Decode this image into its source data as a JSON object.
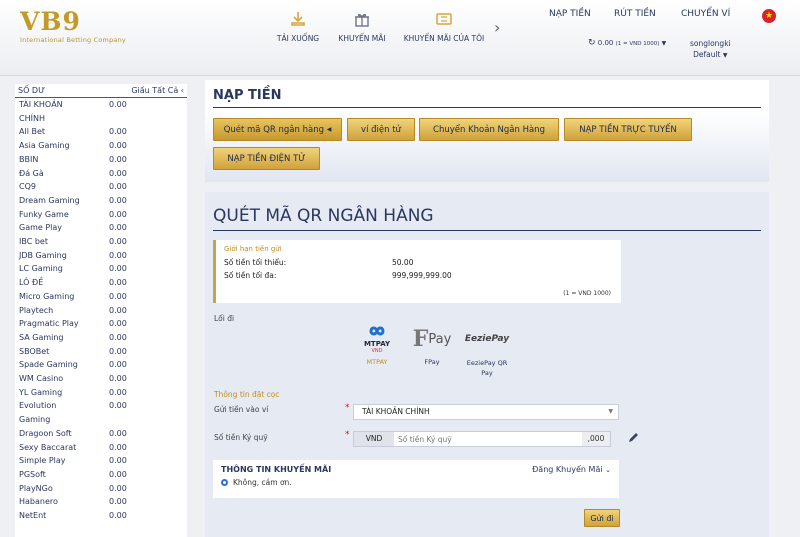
{
  "header": {
    "logo": "VB9",
    "logo_sub": "International Betting Company",
    "nav": [
      {
        "label": "TẢI XUỐNG",
        "icon": "download-icon"
      },
      {
        "label": "KHUYẾN MÃI",
        "icon": "gift-icon"
      },
      {
        "label": "KHUYẾN MÃI CỦA TÔI",
        "icon": "ticket-icon"
      }
    ],
    "links": {
      "deposit": "NẠP TIỀN",
      "withdraw": "RÚT TIỀN",
      "transfer": "CHUYỂN VÍ"
    },
    "balance": "0.00",
    "balance_note": "(1 = VND 1000)",
    "username": "songlongki",
    "profile": "Default",
    "flag": "★"
  },
  "sidebar": {
    "title": "SỐ DƯ",
    "hide_all": "Giấu Tất Cả",
    "rows": [
      {
        "name": "TÀI KHOẢN",
        "value": "0.00"
      },
      {
        "name": "CHÍNH",
        "value": ""
      },
      {
        "name": "All Bet",
        "value": "0.00"
      },
      {
        "name": "Asia Gaming",
        "value": "0.00"
      },
      {
        "name": "BBIN",
        "value": "0.00"
      },
      {
        "name": "Đá Gà",
        "value": "0.00"
      },
      {
        "name": "CQ9",
        "value": "0.00"
      },
      {
        "name": "Dream Gaming",
        "value": "0.00"
      },
      {
        "name": "Funky Game",
        "value": "0.00"
      },
      {
        "name": "Game Play",
        "value": "0.00"
      },
      {
        "name": "IBC bet",
        "value": "0.00"
      },
      {
        "name": "JDB Gaming",
        "value": "0.00"
      },
      {
        "name": "LC Gaming",
        "value": "0.00"
      },
      {
        "name": "LÔ ĐỀ",
        "value": "0.00"
      },
      {
        "name": "Micro Gaming",
        "value": "0.00"
      },
      {
        "name": "Playtech",
        "value": "0.00"
      },
      {
        "name": "Pragmatic Play",
        "value": "0.00"
      },
      {
        "name": "SA Gaming",
        "value": "0.00"
      },
      {
        "name": "SBOBet",
        "value": "0.00"
      },
      {
        "name": "Spade Gaming",
        "value": "0.00"
      },
      {
        "name": "WM Casino",
        "value": "0.00"
      },
      {
        "name": "YL Gaming",
        "value": "0.00"
      },
      {
        "name": "Evolution",
        "value": "0.00"
      },
      {
        "name": "Gaming",
        "value": ""
      },
      {
        "name": "Dragoon Soft",
        "value": "0.00"
      },
      {
        "name": "Sexy Baccarat",
        "value": "0.00"
      },
      {
        "name": "Simple Play",
        "value": "0.00"
      },
      {
        "name": "PGSoft",
        "value": "0.00"
      },
      {
        "name": "PlayNGo",
        "value": "0.00"
      },
      {
        "name": "Habanero",
        "value": "0.00"
      },
      {
        "name": "NetEnt",
        "value": "0.00"
      }
    ]
  },
  "deposit": {
    "title": "NẠP TIỀN",
    "methods": [
      "Quét mã QR ngân hàng",
      "ví điện tử",
      "Chuyển Khoản Ngân Hàng",
      "NẠP TIỀN TRỰC TUYẾN",
      "NẠP TIỀN ĐIỆN TỬ"
    ]
  },
  "form": {
    "title": "QUÉT MÃ QR NGÂN HÀNG",
    "limit_caption": "Giới hạn tiền gửi",
    "min_label": "Số tiền tối thiểu:",
    "min_value": "50.00",
    "max_label": "Số tiền tối đa:",
    "max_value": "999,999,999.00",
    "limit_note": "(1 = VND 1000)",
    "gateway_label": "Lối đi",
    "gateways": [
      {
        "name": "MTPAY",
        "logo": "MTPAY",
        "logo_sub": "VND"
      },
      {
        "name": "FPay",
        "logo": "Pay"
      },
      {
        "name": "EeziePay QR Pay",
        "logo": "EeziePay"
      }
    ],
    "deposit_info": "Thông tin đặt cọc",
    "wallet_label": "Gửi tiền vào ví",
    "wallet_value": "TÀI KHOẢN CHÍNH",
    "amount_label": "Số tiền Ký quỹ",
    "currency": "VND",
    "amount_placeholder": "Số tiền Ký quỹ",
    "amount_suffix": ",000",
    "promo_title": "THÔNG TIN KHUYẾN MÃI",
    "promo_toggle": "Đăng Khuyến Mãi",
    "promo_option": "Không, cám ơn.",
    "submit": "Gửi đi"
  }
}
